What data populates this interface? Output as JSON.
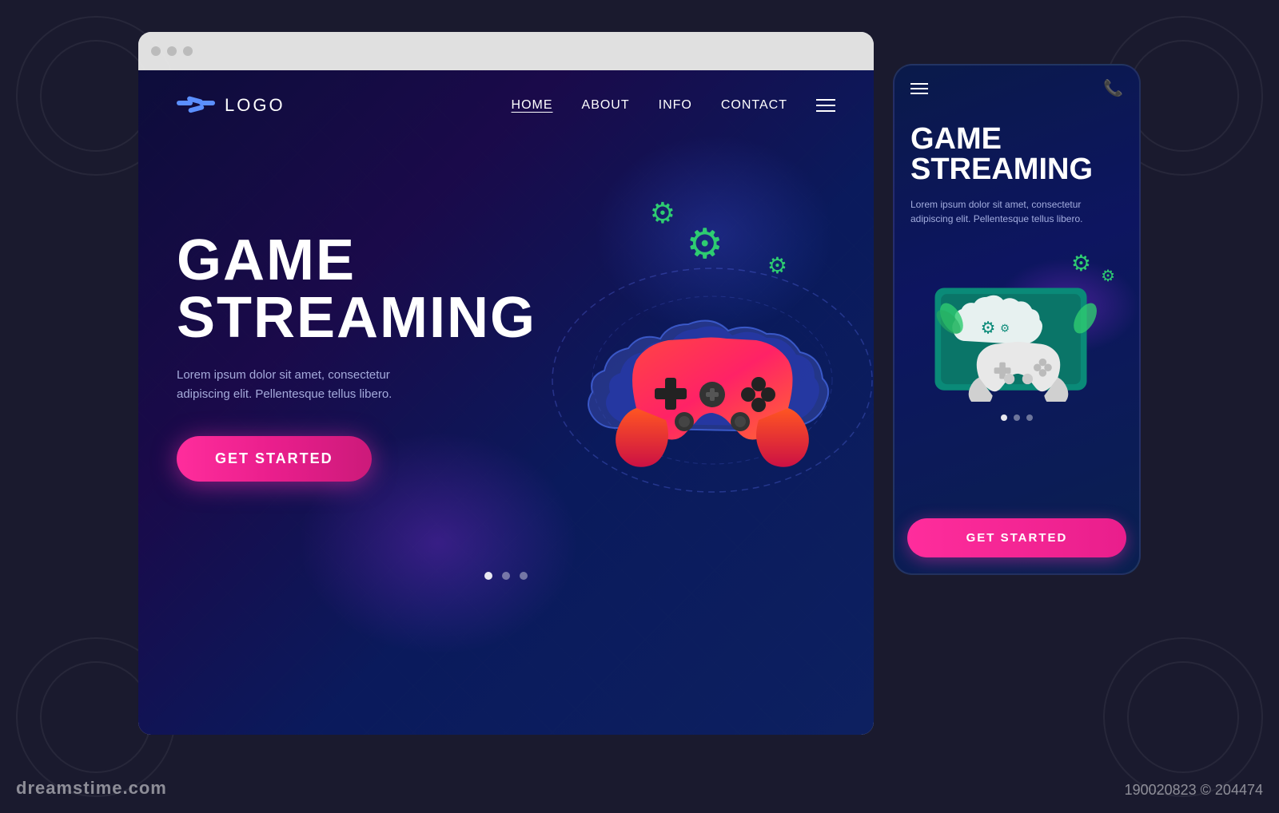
{
  "meta": {
    "bg_color": "#12122a",
    "dreamstime_logo": "dreamstime.com",
    "dreamstime_id": "190020823 © 204474"
  },
  "browser": {
    "dots": [
      "dot1",
      "dot2",
      "dot3"
    ]
  },
  "desktop": {
    "logo_text": "LOGO",
    "nav": {
      "home": "HOME",
      "about": "ABOUT",
      "info": "INFO",
      "contact": "CONTACT"
    },
    "hero_title_line1": "GAME",
    "hero_title_line2": "STREAMING",
    "hero_desc": "Lorem ipsum dolor sit amet, consectetur adipiscing elit. Pellentesque tellus libero.",
    "cta_button": "GET STARTED",
    "pagination_dots": [
      true,
      false,
      false
    ]
  },
  "mobile": {
    "hero_title_line1": "GAME",
    "hero_title_line2": "STREAMING",
    "hero_desc": "Lorem ipsum dolor sit amet, consectetur adipiscing elit. Pellentesque tellus libero.",
    "cta_button": "GET STARTED",
    "pagination_dots": [
      true,
      false,
      false
    ]
  }
}
